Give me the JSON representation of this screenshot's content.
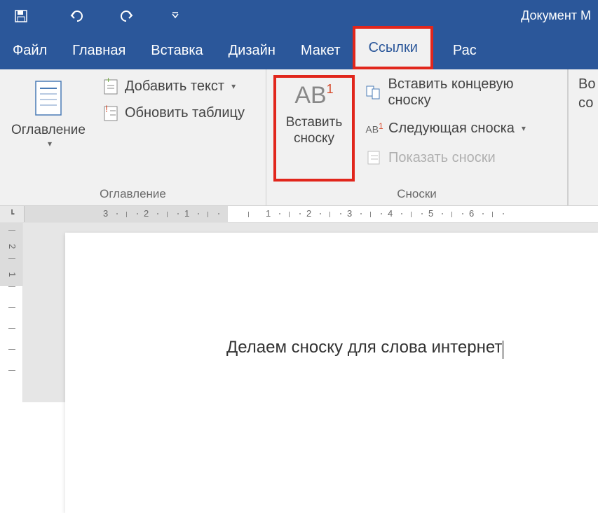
{
  "title": "Документ M",
  "tabs": {
    "file": "Файл",
    "home": "Главная",
    "insert": "Вставка",
    "design": "Дизайн",
    "layout": "Макет",
    "references": "Ссылки",
    "mailings": "Рас"
  },
  "ribbon": {
    "toc": {
      "button": "Оглавление",
      "add_text": "Добавить текст",
      "update_table": "Обновить таблицу",
      "group_label": "Оглавление"
    },
    "footnotes": {
      "insert_footnote": "Вставить\nсноску",
      "ab_text": "AB",
      "insert_endnote": "Вставить концевую сноску",
      "next_footnote": "Следующая сноска",
      "show_notes": "Показать сноски",
      "group_label": "Сноски"
    },
    "right": {
      "line1": "Во",
      "line2": "со"
    }
  },
  "document": {
    "text": "Делаем сноску для слова интернет"
  },
  "ruler_h": [
    "3",
    "2",
    "1",
    "1",
    "2",
    "3",
    "4",
    "5",
    "6"
  ],
  "ruler_v": [
    "2",
    "1"
  ]
}
